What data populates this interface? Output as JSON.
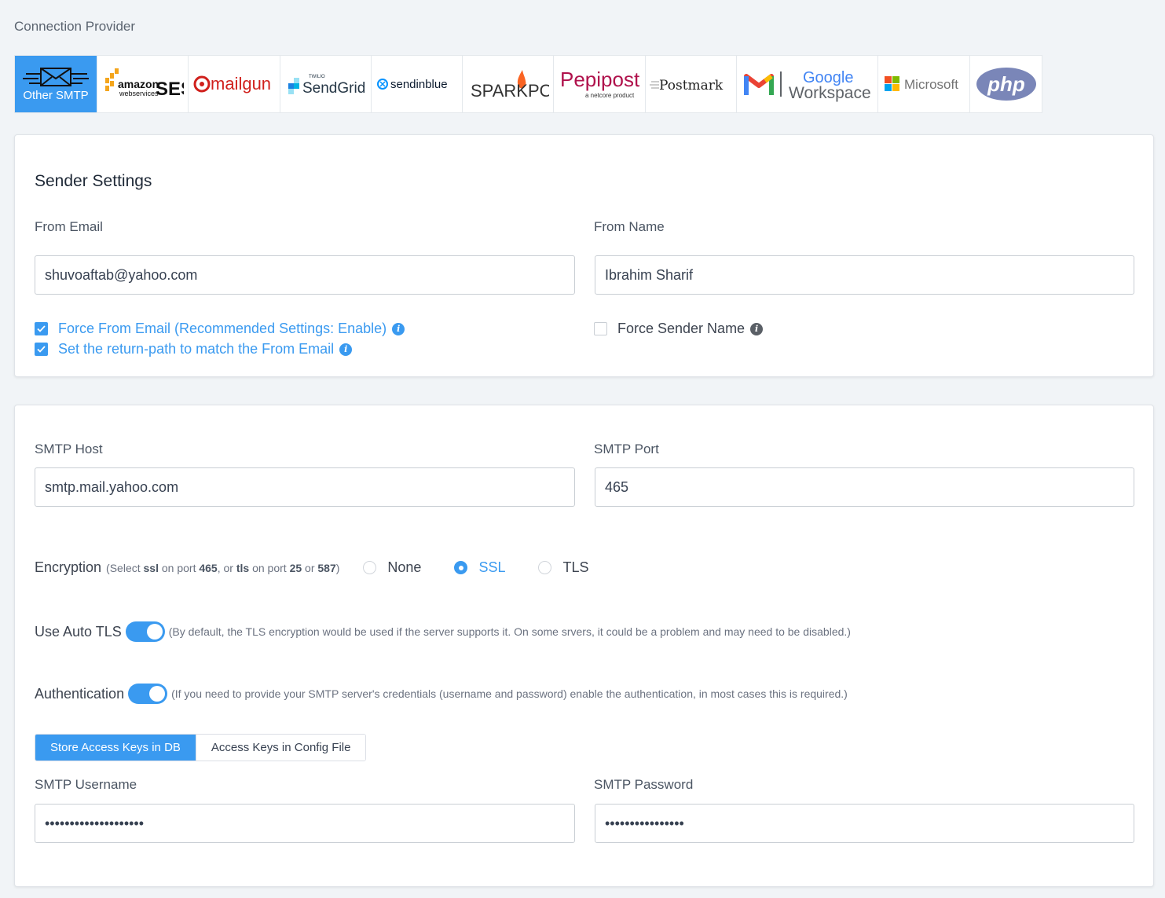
{
  "connection_provider": {
    "label": "Connection Provider",
    "providers": [
      {
        "name": "Other SMTP",
        "active": true
      },
      {
        "name": "amazon SES",
        "sub": "webservices"
      },
      {
        "name": "mailgun"
      },
      {
        "name": "SendGrid",
        "sub": "TWILIO"
      },
      {
        "name": "sendinblue"
      },
      {
        "name": "SPARKPOST"
      },
      {
        "name": "Pepipost",
        "sub": "a netcore product"
      },
      {
        "name": "Postmark"
      },
      {
        "name": "Google Workspace",
        "line1": "Google",
        "line2": "Workspace"
      },
      {
        "name": "Microsoft"
      },
      {
        "name": "php"
      }
    ]
  },
  "sender_settings": {
    "title": "Sender Settings",
    "from_email_label": "From Email",
    "from_email_value": "shuvoaftab@yahoo.com",
    "from_name_label": "From Name",
    "from_name_value": "Ibrahim Sharif",
    "force_from_email": "Force From Email (Recommended Settings: Enable)",
    "return_path": "Set the return-path to match the From Email",
    "force_sender_name": "Force Sender Name"
  },
  "smtp": {
    "host_label": "SMTP Host",
    "host_value": "smtp.mail.yahoo.com",
    "port_label": "SMTP Port",
    "port_value": "465",
    "encryption_label": "Encryption",
    "encryption_hint": {
      "p1": "(Select ",
      "ssl": "ssl",
      "p2": " on port ",
      "port465": "465",
      "p3": ", or ",
      "tls": "tls",
      "p4": " on port ",
      "port25": "25",
      "p5": " or ",
      "port587": "587",
      "p6": ")"
    },
    "encryption_options": [
      "None",
      "SSL",
      "TLS"
    ],
    "encryption_selected": "SSL",
    "auto_tls_label": "Use Auto TLS",
    "auto_tls_hint": "(By default, the TLS encryption would be used if the server supports it. On some srvers, it could be a problem and may need to be disabled.)",
    "auth_label": "Authentication",
    "auth_hint": "(If you need to provide your SMTP server's credentials (username and password) enable the authentication, in most cases this is required.)",
    "key_storage_options": [
      "Store Access Keys in DB",
      "Access Keys in Config File"
    ],
    "key_storage_selected": "Store Access Keys in DB",
    "username_label": "SMTP Username",
    "username_value": "••••••••••••••••••••",
    "password_label": "SMTP Password",
    "password_value": "••••••••••••••••"
  },
  "colors": {
    "accent": "#3a9af0",
    "background": "#f1f4f7",
    "mailgun": "#d0201c",
    "pepipost": "#b0124c",
    "sendgrid": "#1a82e2",
    "php": "#7a86b8"
  }
}
